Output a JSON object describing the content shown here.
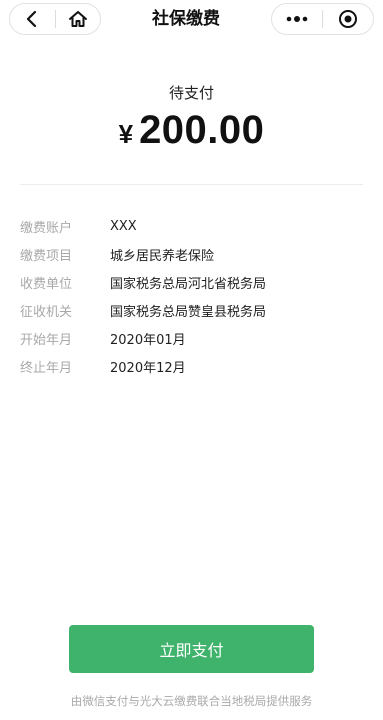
{
  "nav": {
    "title": "社保缴费",
    "icons": {
      "back": "chevron-left-icon",
      "home": "home-icon",
      "more": "more-dots-icon",
      "close": "mini-program-close-icon"
    }
  },
  "payment": {
    "status": "待支付",
    "currency_symbol": "¥",
    "amount": "200.00"
  },
  "details": [
    {
      "label": "缴费账户",
      "value": "XXX"
    },
    {
      "label": "缴费项目",
      "value": "城乡居民养老保险"
    },
    {
      "label": "收费单位",
      "value": "国家税务总局河北省税务局"
    },
    {
      "label": "征收机关",
      "value": "国家税务总局赞皇县税务局"
    },
    {
      "label": "开始年月",
      "value": "2020年01月"
    },
    {
      "label": "终止年月",
      "value": "2020年12月"
    }
  ],
  "actions": {
    "pay_label": "立即支付"
  },
  "footer": {
    "note": "由微信支付与光大云缴费联合当地税局提供服务"
  },
  "colors": {
    "accent": "#3fb36b",
    "label_gray": "#a8a8a8",
    "text": "#1f1f1f"
  }
}
